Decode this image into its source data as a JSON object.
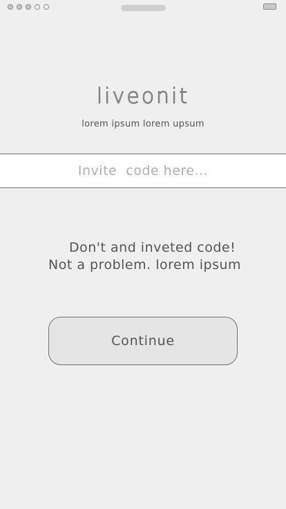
{
  "status_bar": {
    "signal_dots": [
      "filled",
      "filled",
      "filled",
      "empty",
      "empty"
    ],
    "notch_icon": "speaker-notch-icon",
    "battery_icon": "battery-icon"
  },
  "header": {
    "app_name": "liveonit",
    "tagline": "lorem ipsum lorem upsum"
  },
  "invite": {
    "placeholder": "Invite  code here..."
  },
  "message": {
    "line1": "Don't and inveted code!",
    "line2": "Not a problem. lorem ipsum"
  },
  "actions": {
    "continue_label": "Continue"
  }
}
